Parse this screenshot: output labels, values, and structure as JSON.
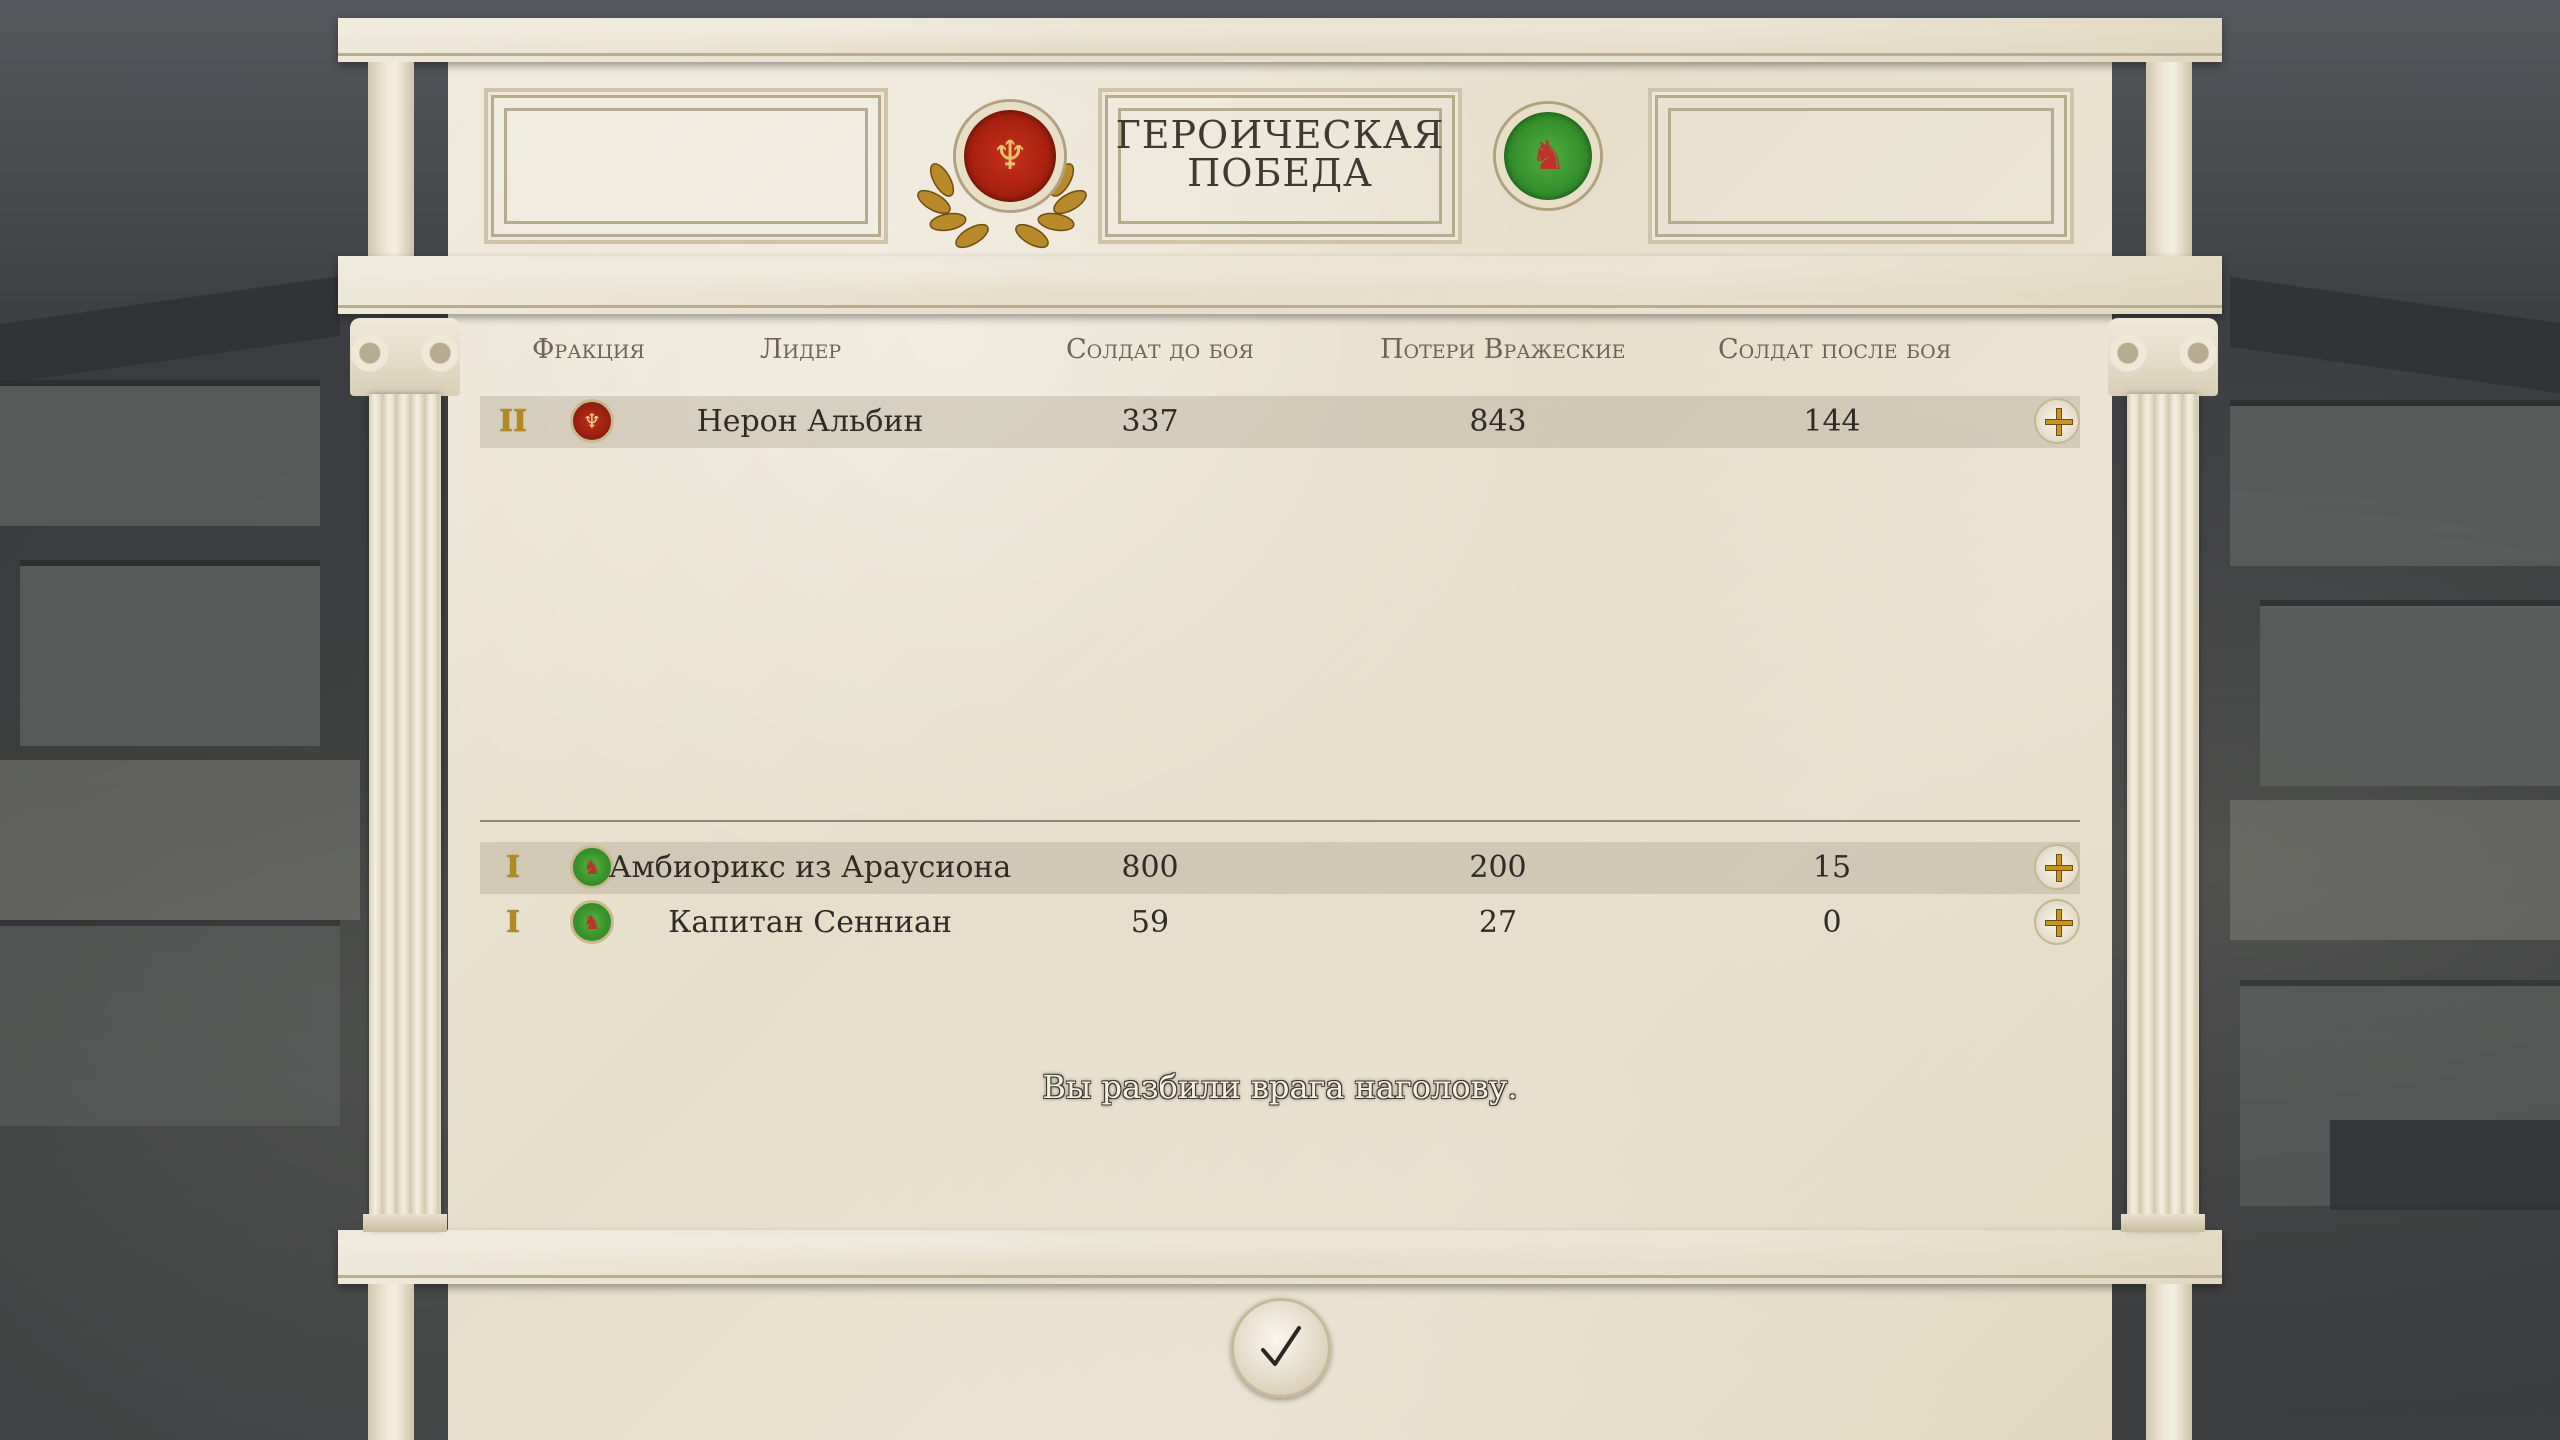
{
  "header": {
    "title_line1": "ГЕРОИЧЕСКАЯ",
    "title_line2": "ПОБЕДА",
    "left_emblem": "roman-faction-emblem",
    "right_emblem": "boar-faction-emblem"
  },
  "columns": {
    "faction": "Фракция",
    "leader": "Лидер",
    "soldiers_before": "Солдат до боя",
    "enemy_losses": "Потери Вражеские",
    "soldiers_after": "Солдат после боя"
  },
  "player_rows": [
    {
      "rank": "II",
      "faction_color": "red",
      "leader": "Нерон Альбин",
      "before": "337",
      "losses": "843",
      "after": "144"
    }
  ],
  "enemy_rows": [
    {
      "rank": "I",
      "faction_color": "green",
      "leader": "Амбиорикс из Араусиона",
      "before": "800",
      "losses": "200",
      "after": "15"
    },
    {
      "rank": "I",
      "faction_color": "green",
      "leader": "Капитан Сенниан",
      "before": "59",
      "losses": "27",
      "after": "0"
    }
  ],
  "message": "Вы разбили врага наголову.",
  "confirm_icon": "checkmark-icon",
  "colors": {
    "accent_gold": "#c9951b",
    "roman_red": "#a6200f",
    "gaul_green": "#2f8a2a",
    "marble": "#ece5d4"
  }
}
